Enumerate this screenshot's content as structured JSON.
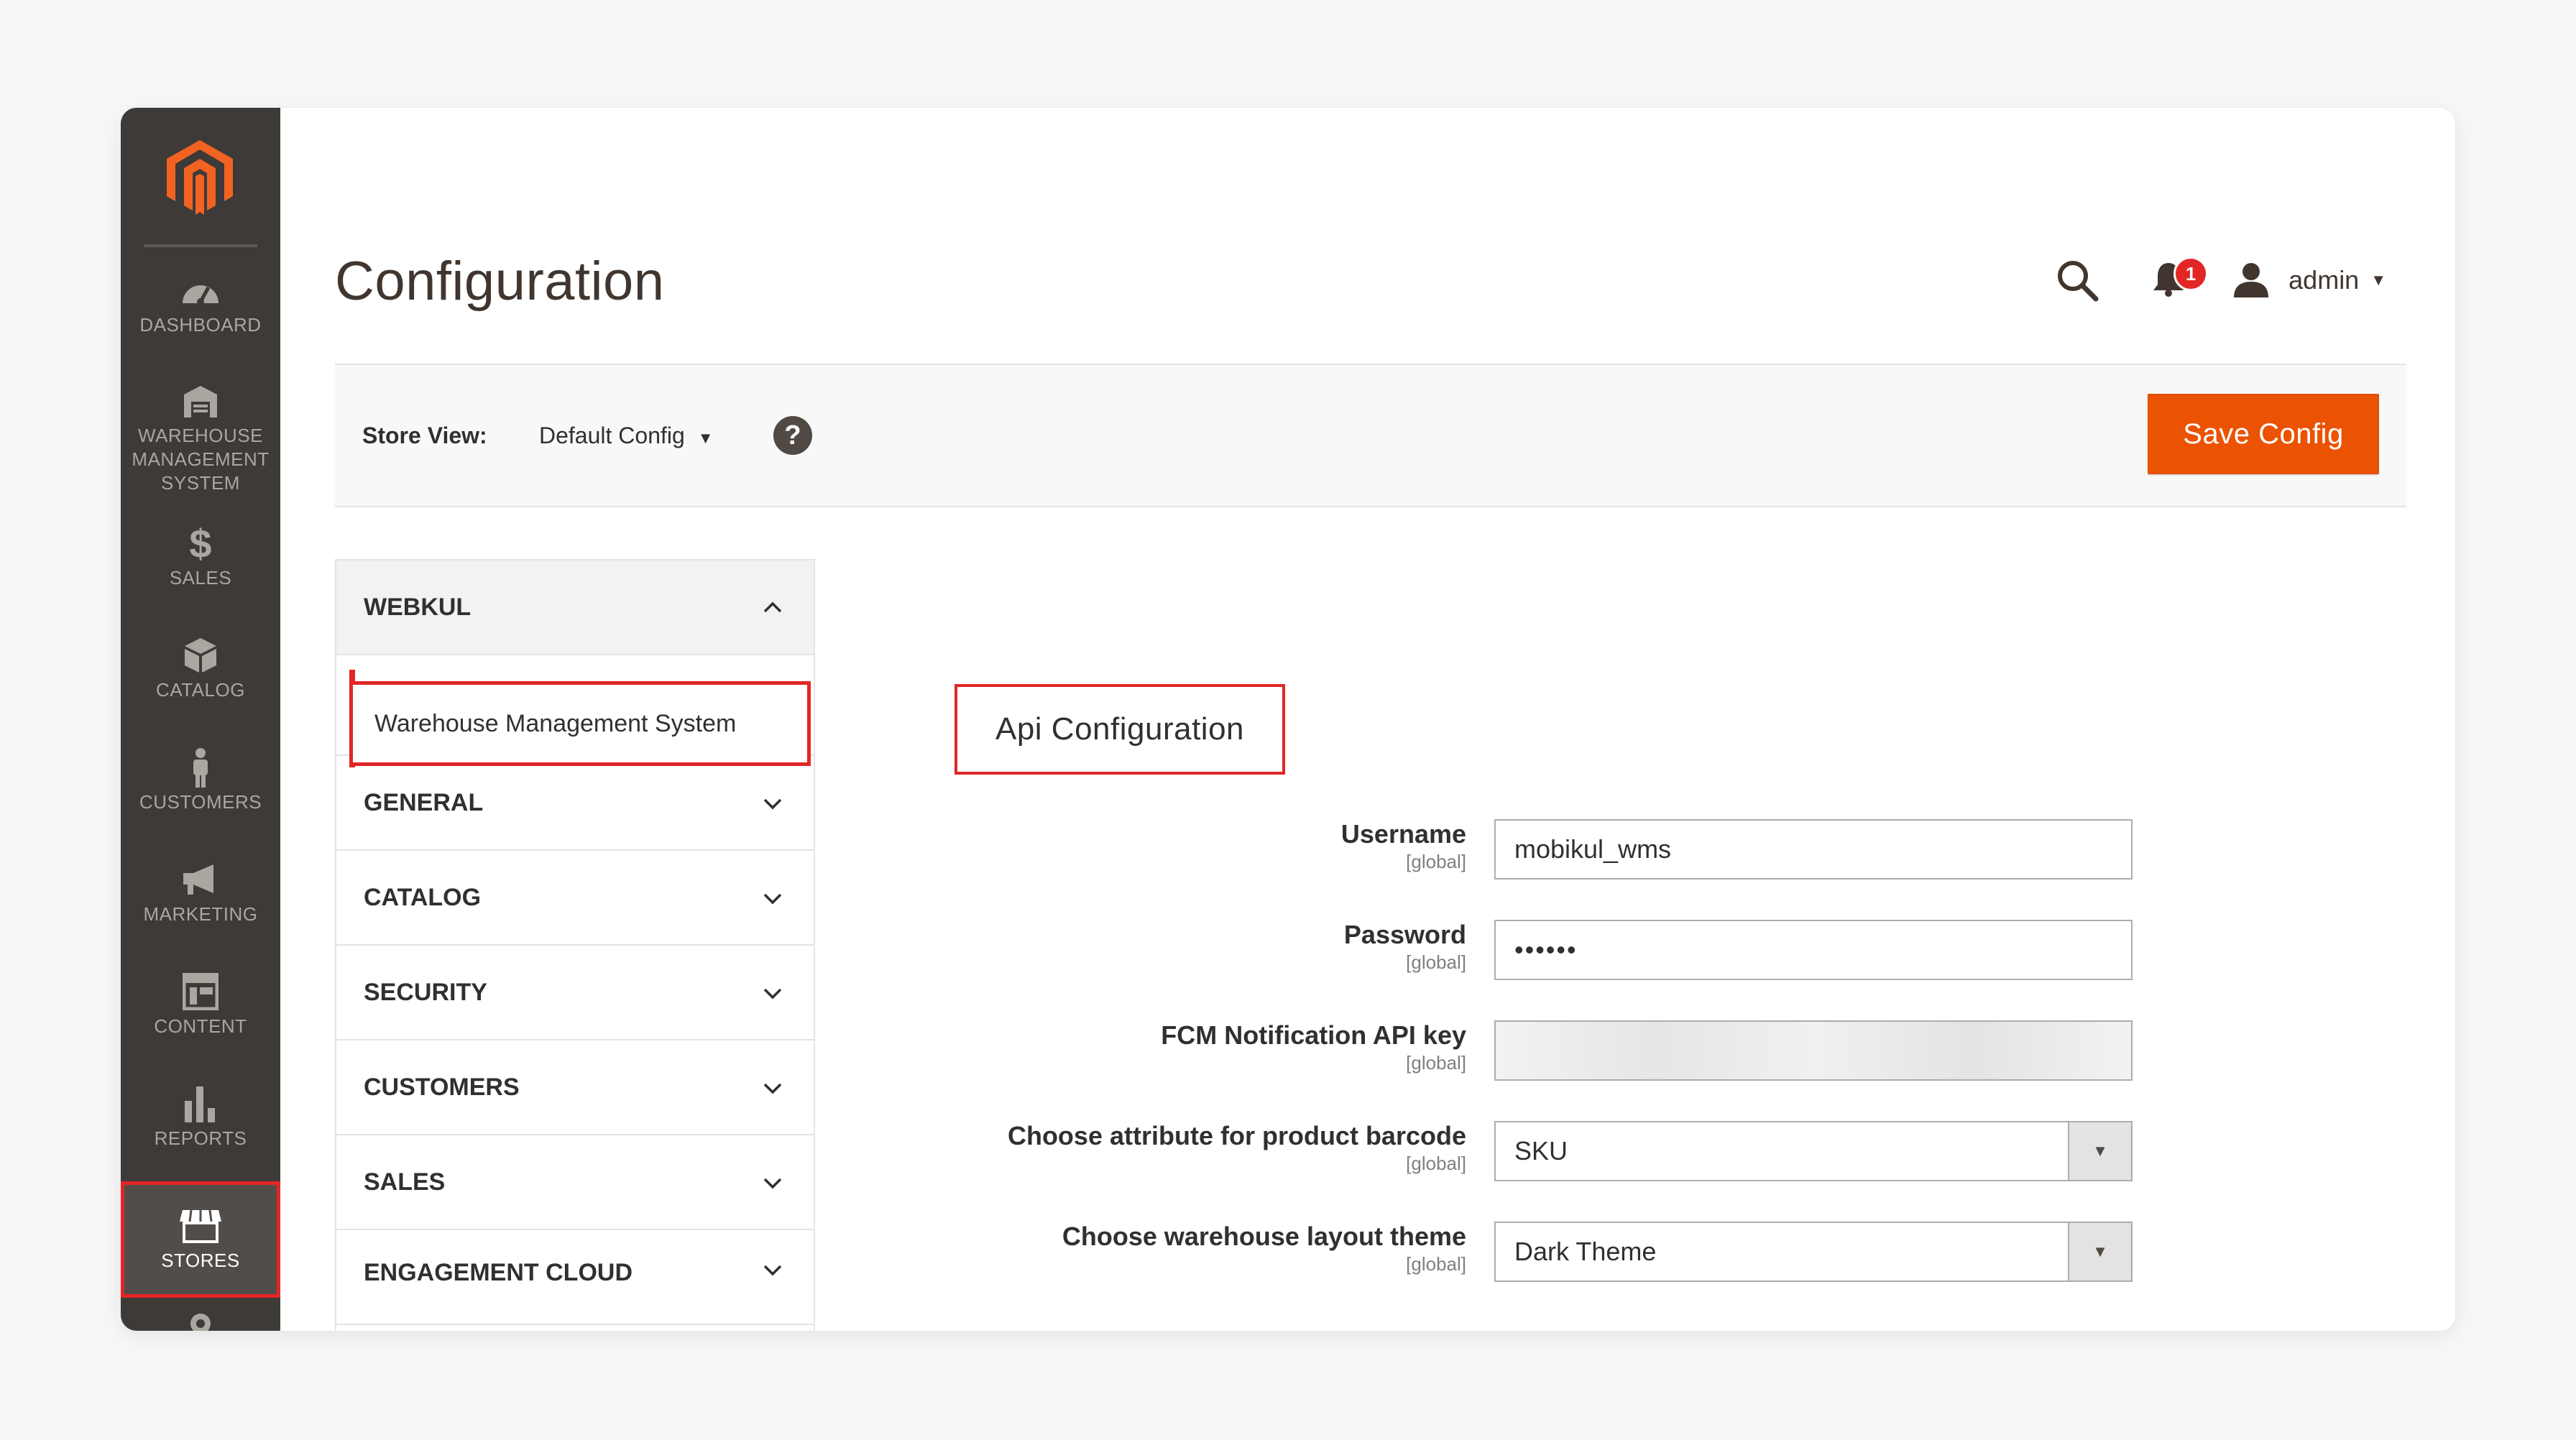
{
  "sidebar": {
    "logo": "magento-logo",
    "items": [
      {
        "label": "DASHBOARD",
        "icon": "dashboard-icon"
      },
      {
        "label": "WAREHOUSE\nMANAGEMENT\nSYSTEM",
        "icon": "warehouse-icon"
      },
      {
        "label": "SALES",
        "icon": "dollar-icon"
      },
      {
        "label": "CATALOG",
        "icon": "box-icon"
      },
      {
        "label": "CUSTOMERS",
        "icon": "person-icon"
      },
      {
        "label": "MARKETING",
        "icon": "megaphone-icon"
      },
      {
        "label": "CONTENT",
        "icon": "layout-icon"
      },
      {
        "label": "REPORTS",
        "icon": "bar-chart-icon"
      },
      {
        "label": "STORES",
        "icon": "store-icon",
        "active": true
      }
    ]
  },
  "header": {
    "title": "Configuration",
    "notification_count": "1",
    "user_name": "admin"
  },
  "store_view": {
    "label": "Store View:",
    "selected": "Default Config",
    "save_label": "Save Config"
  },
  "config_nav": {
    "sections": [
      {
        "label": "WEBKUL",
        "open": true,
        "items": [
          "Warehouse Management System"
        ]
      },
      {
        "label": "GENERAL"
      },
      {
        "label": "CATALOG"
      },
      {
        "label": "SECURITY"
      },
      {
        "label": "CUSTOMERS"
      },
      {
        "label": "SALES"
      },
      {
        "label": "ENGAGEMENT CLOUD"
      }
    ]
  },
  "api_config": {
    "title": "Api Configuration",
    "fields": [
      {
        "label": "Username",
        "scope": "[global]",
        "value": "mobikul_wms",
        "type": "text"
      },
      {
        "label": "Password",
        "scope": "[global]",
        "value": "••••••",
        "type": "password"
      },
      {
        "label": "FCM Notification API key",
        "scope": "[global]",
        "value": "",
        "type": "text"
      },
      {
        "label": "Choose attribute for product barcode",
        "scope": "[global]",
        "value": "SKU",
        "type": "select"
      },
      {
        "label": "Choose warehouse layout theme",
        "scope": "[global]",
        "value": "Dark Theme",
        "type": "select"
      }
    ]
  },
  "colors": {
    "sidebar_bg": "#3d3a38",
    "accent": "#eb5202",
    "highlight": "#e22626"
  }
}
